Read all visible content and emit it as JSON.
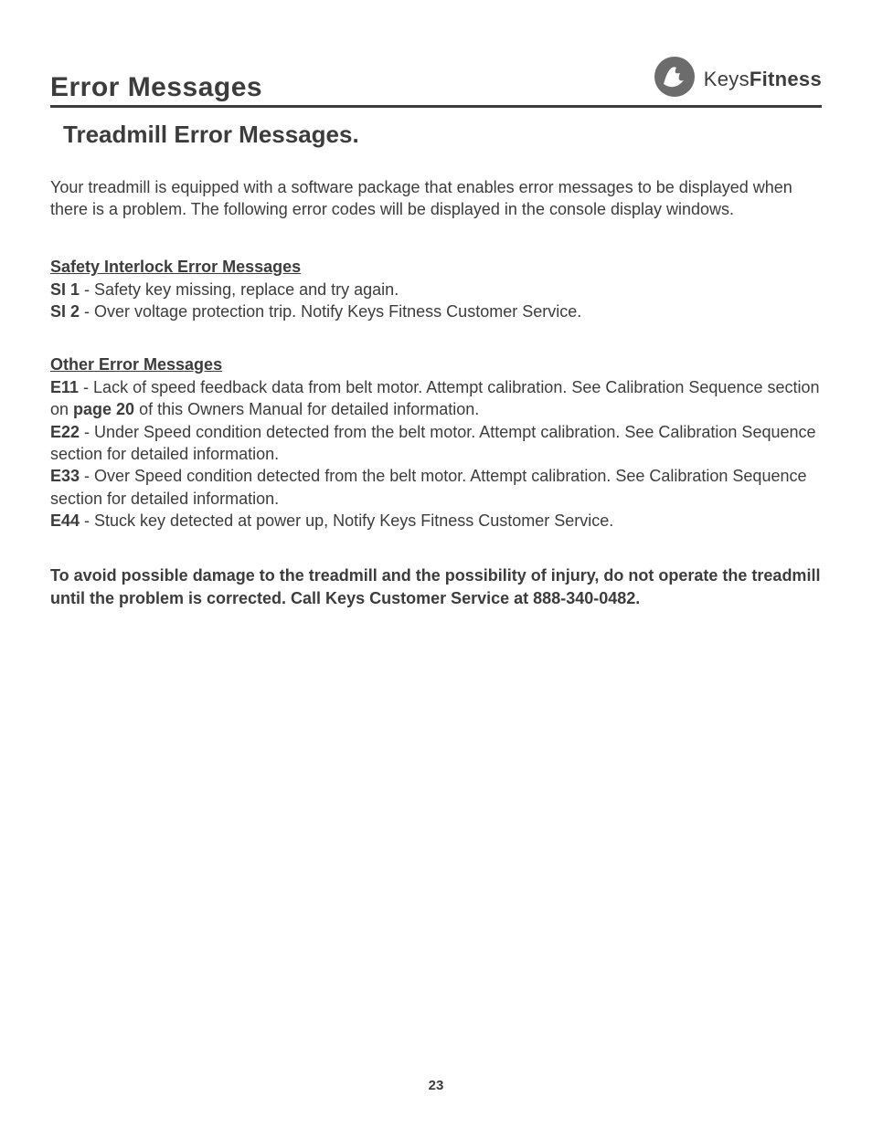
{
  "header": {
    "title": "Error Messages",
    "brand_a": "Keys",
    "brand_b": "Fitness"
  },
  "section_title": "Treadmill Error Messages",
  "intro": "Your treadmill is equipped with a software package that enables error messages to be displayed when there is a problem. The following error codes will be displayed in the console display windows.",
  "safety": {
    "heading": "Safety Interlock Error Messages",
    "items": [
      {
        "code": "SI 1",
        "desc": " - Safety key missing, replace and try again."
      },
      {
        "code": "SI 2",
        "desc": " - Over voltage protection trip. Notify Keys Fitness Customer Service."
      }
    ]
  },
  "other": {
    "heading": "Other Error Messages",
    "e11_code": "E11",
    "e11_a": " - Lack of speed feedback data from belt motor. Attempt calibration. See Calibration Sequence section on ",
    "e11_pg": "page 20",
    "e11_b": " of this Owners Manual for detailed information.",
    "e22_code": "E22",
    "e22": " - Under Speed condition detected from the belt motor. Attempt calibration. See Calibration Sequence section for detailed information.",
    "e33_code": "E33",
    "e33": " - Over Speed condition detected from the belt motor. Attempt calibration. See Calibration Sequence section for detailed information.",
    "e44_code": "E44",
    "e44": " - Stuck key detected at power up, Notify Keys Fitness Customer Service."
  },
  "warning": "To avoid possible damage to the treadmill and the possibility of injury, do not operate the treadmill until the problem is corrected. Call Keys Customer Service at 888-340-0482.",
  "page_number": "23"
}
